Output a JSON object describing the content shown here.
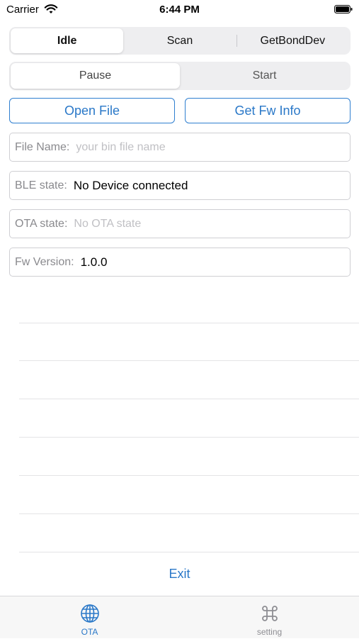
{
  "status_bar": {
    "carrier": "Carrier",
    "time": "6:44 PM"
  },
  "mode_segment": {
    "items": [
      "Idle",
      "Scan",
      "GetBondDev"
    ],
    "selected": "Idle"
  },
  "run_segment": {
    "items": [
      "Pause",
      "Start"
    ],
    "selected": "Pause"
  },
  "buttons": {
    "open_file": "Open File",
    "get_fw_info": "Get Fw Info"
  },
  "fields": {
    "file_name": {
      "label": "File Name:",
      "placeholder": "your bin file name"
    },
    "ble_state": {
      "label": "BLE state:",
      "value": "No Device connected"
    },
    "ota_state": {
      "label": "OTA state:",
      "placeholder": "No OTA state"
    },
    "fw_version": {
      "label": "Fw Version:",
      "value": "1.0.0"
    }
  },
  "exit_label": "Exit",
  "tabbar": {
    "tabs": [
      {
        "label": "OTA",
        "icon": "globe-icon",
        "selected": true
      },
      {
        "label": "setting",
        "icon": "command-icon",
        "selected": false
      }
    ]
  },
  "colors": {
    "accent": "#2a78c8",
    "inactive": "#8e8e93"
  }
}
